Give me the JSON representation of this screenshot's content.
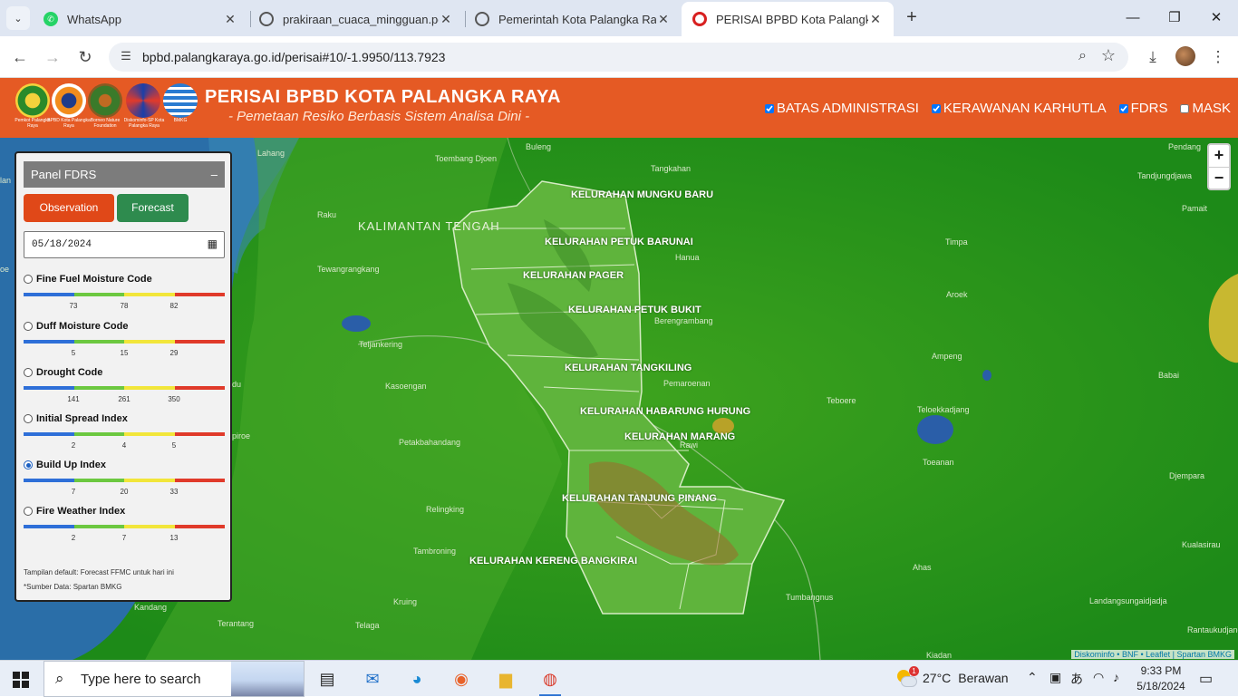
{
  "browser": {
    "tabs": [
      {
        "title": "WhatsApp",
        "icon": "whatsapp-icon"
      },
      {
        "title": "prakiraan_cuaca_mingguan.pdf",
        "icon": "globe-icon"
      },
      {
        "title": "Pemerintah Kota Palangka Raya",
        "icon": "globe-icon"
      },
      {
        "title": "PERISAI BPBD Kota Palangka Raya",
        "icon": "bpbd-icon",
        "active": true
      }
    ],
    "new_tab": "+",
    "url": "bpbd.palangkaraya.go.id/perisai#10/-1.9950/113.7923"
  },
  "header": {
    "title": "PERISAI BPBD KOTA PALANGKA RAYA",
    "subtitle": "- Pemetaan Resiko Berbasis Sistem Analisa Dini -",
    "logos": [
      {
        "caption": "Pemkot Palangka Raya"
      },
      {
        "caption": "BPBD Kota Palangka Raya"
      },
      {
        "caption": "Borneo Nature Foundation"
      },
      {
        "caption": "Diskominfo-SP Kota Palangka Raya"
      },
      {
        "caption": "BMKG"
      }
    ],
    "layers": [
      {
        "label": "BATAS ADMINISTRASI",
        "checked": true
      },
      {
        "label": "KERAWANAN KARHUTLA",
        "checked": true
      },
      {
        "label": "FDRS",
        "checked": true
      },
      {
        "label": "MASK",
        "checked": false
      }
    ]
  },
  "panel": {
    "title": "Panel FDRS",
    "minimize": "–",
    "observation": "Observation",
    "forecast": "Forecast",
    "date": "05/18/2024",
    "scale_colors": [
      "#2e6fd8",
      "#6cc840",
      "#f2e63a",
      "#e03a2a"
    ],
    "indices": [
      {
        "name": "Fine Fuel Moisture Code",
        "ticks": [
          "73",
          "78",
          "82"
        ],
        "selected": false
      },
      {
        "name": "Duff Moisture Code",
        "ticks": [
          "5",
          "15",
          "29"
        ],
        "selected": false
      },
      {
        "name": "Drought Code",
        "ticks": [
          "141",
          "261",
          "350"
        ],
        "selected": false
      },
      {
        "name": "Initial Spread Index",
        "ticks": [
          "2",
          "4",
          "5"
        ],
        "selected": false
      },
      {
        "name": "Build Up Index",
        "ticks": [
          "7",
          "20",
          "33"
        ],
        "selected": true
      },
      {
        "name": "Fire Weather Index",
        "ticks": [
          "2",
          "7",
          "13"
        ],
        "selected": false
      }
    ],
    "note_default": "Tampilan default: Forecast FFMC untuk hari ini",
    "note_source": "*Sumber Data: Spartan BMKG"
  },
  "map": {
    "region": "KALIMANTAN TENGAH",
    "kelurahan": [
      "KELURAHAN MUNGKU BARU",
      "KELURAHAN PETUK BARUNAI",
      "KELURAHAN PAGER",
      "KELURAHAN PETUK BUKIT",
      "KELURAHAN TANGKILING",
      "KELURAHAN HABARUNG HURUNG",
      "KELURAHAN MARANG",
      "KELURAHAN TANJUNG PINANG",
      "KELURAHAN KERENG BANGKIRAI"
    ],
    "places": [
      "Buleng",
      "Lahang",
      "Toembang Djoen",
      "Tangkahan",
      "Pendang",
      "Tandjungdjawa",
      "Raku",
      "Pamait",
      "Hanua",
      "Timpa",
      "Tewangrangkang",
      "Aroek",
      "Berengrambang",
      "Teljankering",
      "Ampeng",
      "Pemaroenan",
      "Babai",
      "Kasoengan",
      "Teboere",
      "Teloekkadjang",
      "Rawi",
      "Petakbahandang",
      "Toeanan",
      "Djempara",
      "Relingking",
      "Tambroning",
      "Kualasirau",
      "Ahas",
      "Tumbangnus",
      "Kruing",
      "Landangsungaidjadja",
      "Kandang",
      "Terantang",
      "Telaga",
      "Rantaukudjang",
      "Kiadan",
      "oe",
      "du",
      "piroe",
      "lan"
    ],
    "zoom_in": "+",
    "zoom_out": "−",
    "attribution": "Diskominfo • BNF • Leaflet | Spartan BMKG"
  },
  "taskbar": {
    "search_placeholder": "Type here to search",
    "weather_temp": "27°C",
    "weather_desc": "Berawan",
    "weather_badge": "1",
    "time": "9:33 PM",
    "date": "5/18/2024"
  }
}
